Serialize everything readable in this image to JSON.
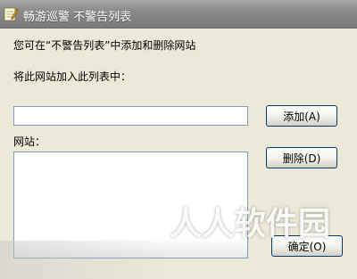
{
  "window": {
    "title": "畅游巡警 不警告列表",
    "icon": "notepad-pencil-icon"
  },
  "dialog": {
    "description": "您可在“不警告列表”中添加和删除网站",
    "add_label": "将此网站加入此列表中：",
    "url_input_value": "",
    "sites_label": "网站：",
    "sites": []
  },
  "buttons": {
    "add": "添加(A)",
    "delete": "删除(D)",
    "ok": "确定(O)"
  },
  "watermark": "人人软件园",
  "colors": {
    "titlebar": "#8a8a8a",
    "dialog_bg": "#ece9d8",
    "input_border": "#7f9db9",
    "button_border": "#003c74"
  }
}
